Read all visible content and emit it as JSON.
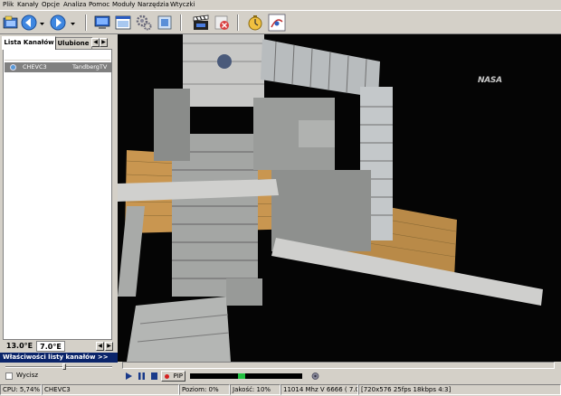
{
  "menu": [
    "Plik",
    "Kanały",
    "Opcje",
    "Analiza",
    "Pomoc",
    "Moduły",
    "Narzędzia",
    "Wtyczki"
  ],
  "tabs": {
    "active": "Lista Kanałów",
    "inactive": "Ulubione"
  },
  "channels": [
    {
      "name": "CHEVC3",
      "provider": "TandbergTV"
    }
  ],
  "position": {
    "left": "13.0°E",
    "right": "7.0°E"
  },
  "properties_label": "Właściwości listy kanałów >>",
  "mute_label": "Wycisz",
  "video_overlay_logo": "NASA",
  "controls": {
    "pip_label": "PIP"
  },
  "status": {
    "cpu": "CPU: 5,74%",
    "channel": "CHEVC3",
    "level": "Poziom: 0%",
    "quality": "Jakość: 10%",
    "frequency": "11014 Mhz  V  6666  ( 7.0° E)",
    "video_info": "[720x576  25fps  18kbps  4:3]"
  },
  "colors": {
    "accent": "#0a246a",
    "highlight": "#808080",
    "record": "#d62020",
    "meter_fill": "#22c040"
  }
}
